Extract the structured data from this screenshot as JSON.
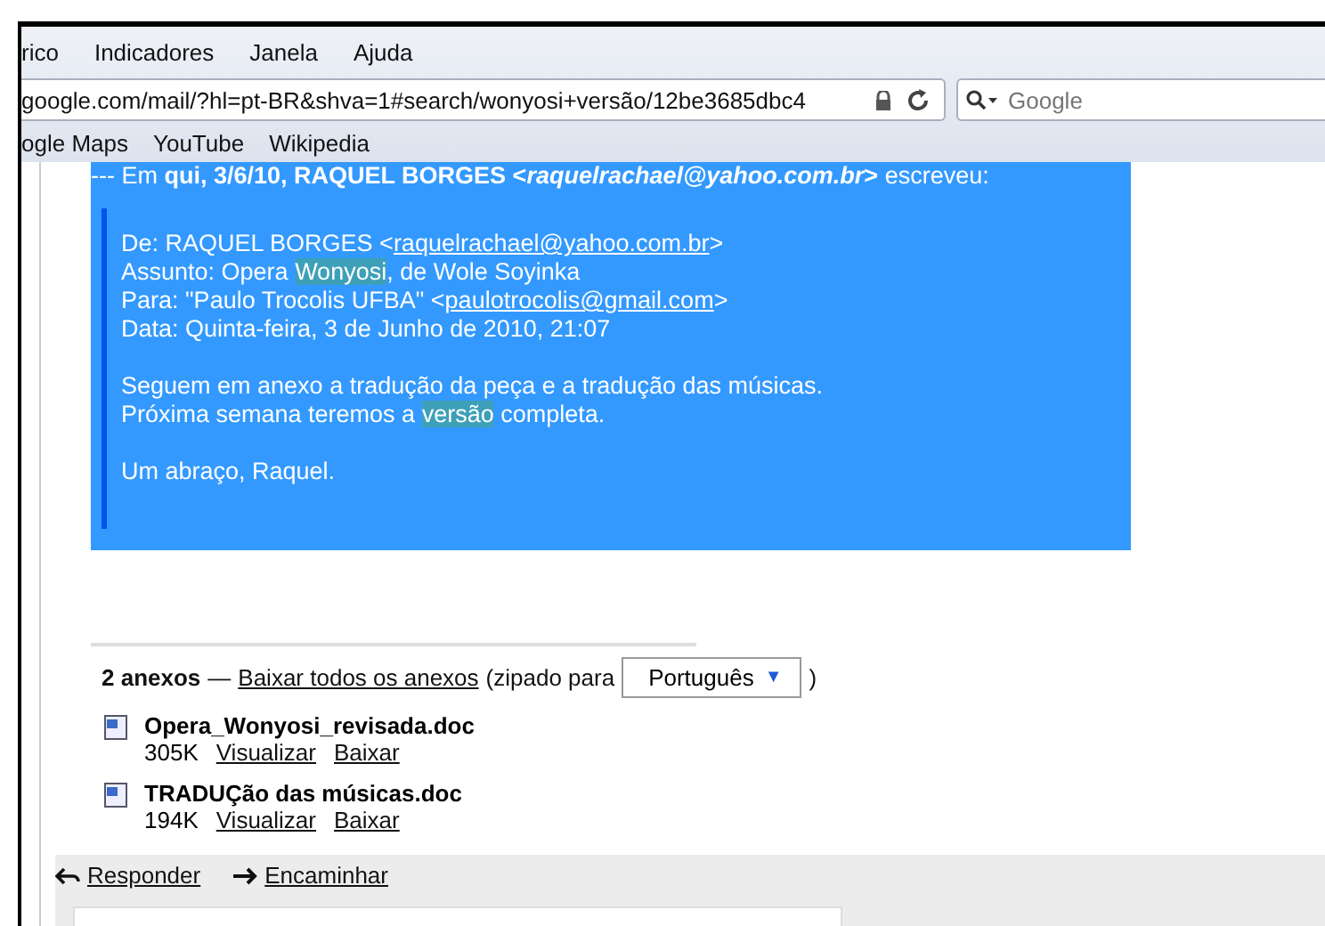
{
  "menu": [
    "rico",
    "Indicadores",
    "Janela",
    "Ajuda"
  ],
  "address_bar": {
    "url": "google.com/mail/?hl=pt-BR&shva=1#search/wonyosi+versão/12be3685dbc4"
  },
  "search": {
    "placeholder": "Google"
  },
  "bookmarks": [
    "ogle Maps",
    "YouTube",
    "Wikipedia"
  ],
  "message": {
    "header": "--- Em **qui, 3/6/10, RAQUEL BORGES <*raquelrachael@yahoo.com.br*>** escreveu:",
    "paragraphs": [
      [
        [
          {
            "kind": "text",
            "text": "De: RAQUEL BORGES <"
          },
          {
            "kind": "link",
            "text": "raquelrachael@yahoo.com.br"
          },
          {
            "kind": "text",
            "text": ">"
          }
        ],
        [
          {
            "kind": "text",
            "text": "Assunto: Opera "
          },
          {
            "kind": "match",
            "text": "Wonyosi"
          },
          {
            "kind": "text",
            "text": ", de Wole Soyinka"
          }
        ],
        [
          {
            "kind": "text",
            "text": "Para: \"Paulo Trocolis UFBA\" <"
          },
          {
            "kind": "link",
            "text": "paulotrocolis@gmail.com"
          },
          {
            "kind": "text",
            "text": ">"
          }
        ],
        [
          {
            "kind": "text",
            "text": "Data: Quinta-feira, 3 de Junho de 2010, 21:07"
          }
        ]
      ],
      [
        [
          {
            "kind": "text",
            "text": "Seguem em anexo a tradução da peça e a tradução das músicas."
          }
        ],
        [
          {
            "kind": "text",
            "text": "Próxima semana teremos a "
          },
          {
            "kind": "match",
            "text": "versão"
          },
          {
            "kind": "text",
            "text": " completa."
          }
        ]
      ],
      [
        [
          {
            "kind": "text",
            "text": "Um abraço, Raquel."
          }
        ]
      ]
    ]
  },
  "attachments": {
    "count": "2 anexos",
    "dash": "—",
    "download_all": "Baixar todos os anexos",
    "zip_label": "(zipado para",
    "language": "Português",
    "caret": "▼",
    "close_paren": ")",
    "files": [
      {
        "name": "Opera_Wonyosi_revisada.doc",
        "size": "305K",
        "view": "Visualizar",
        "download": "Baixar"
      },
      {
        "name": "TRADUÇão das músicas.doc",
        "size": "194K",
        "view": "Visualizar",
        "download": "Baixar"
      }
    ]
  },
  "actions": [
    "Responder",
    "Encaminhar"
  ]
}
